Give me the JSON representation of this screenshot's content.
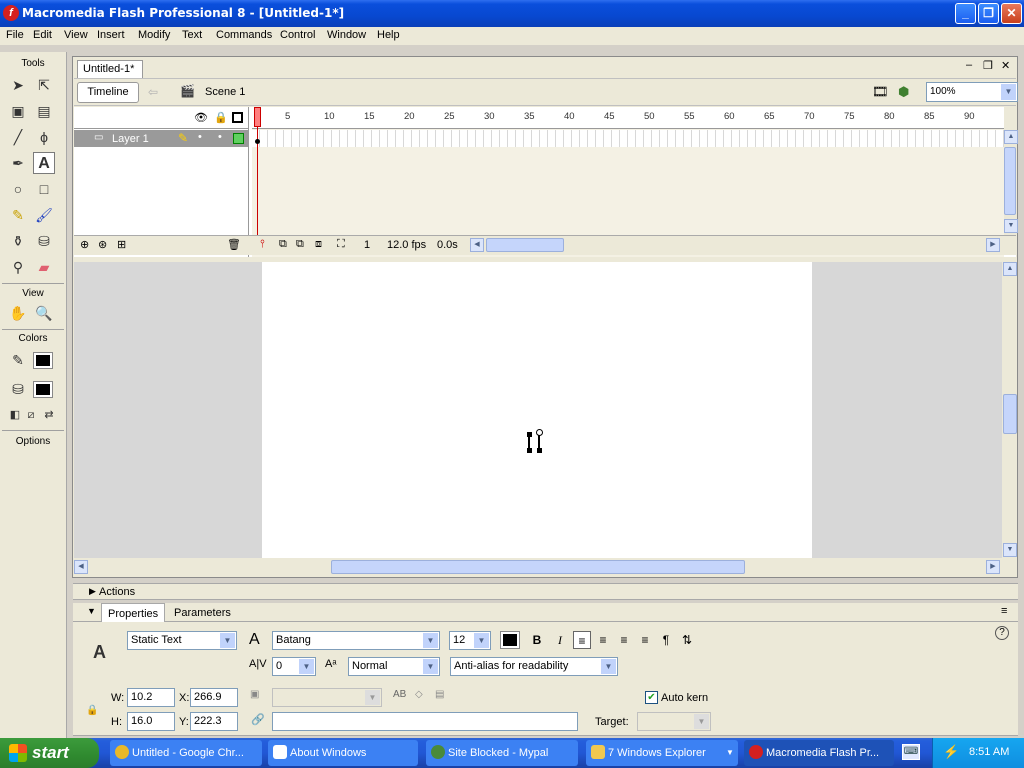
{
  "window": {
    "title": "Macromedia Flash Professional 8 - [Untitled-1*]",
    "app_icon_glyph": "f"
  },
  "menu": [
    "File",
    "Edit",
    "View",
    "Insert",
    "Modify",
    "Text",
    "Commands",
    "Control",
    "Window",
    "Help"
  ],
  "tools": {
    "title": "Tools",
    "view_label": "View",
    "colors_label": "Colors",
    "options_label": "Options"
  },
  "document": {
    "tab": "Untitled-1*",
    "timeline_button": "Timeline",
    "scene": "Scene 1",
    "zoom": "100%"
  },
  "timeline": {
    "layer_name": "Layer 1",
    "ruler": [
      "1",
      "5",
      "10",
      "15",
      "20",
      "25",
      "30",
      "35",
      "40",
      "45",
      "50",
      "55",
      "60",
      "65",
      "70",
      "75",
      "80",
      "85",
      "90"
    ],
    "current_frame": "1",
    "fps": "12.0 fps",
    "elapsed": "0.0s"
  },
  "panels": {
    "actions_label": "Actions",
    "properties_tab": "Properties",
    "parameters_tab": "Parameters"
  },
  "properties": {
    "text_type": "Static Text",
    "font": "Batang",
    "font_size": "12",
    "letter_spacing": "0",
    "char_position": "Normal",
    "anti_alias": "Anti-alias for readability",
    "w_label": "W:",
    "w": "10.2",
    "h_label": "H:",
    "h": "16.0",
    "x_label": "X:",
    "x": "266.9",
    "y_label": "Y:",
    "y": "222.3",
    "auto_kern": "Auto kern",
    "target_label": "Target:",
    "bold": "B",
    "italic": "I"
  },
  "taskbar": {
    "start": "start",
    "tasks": [
      {
        "label": "Untitled - Google Chr...",
        "color": "#e8b82a"
      },
      {
        "label": "About Windows",
        "color": "#ffffff"
      },
      {
        "label": "Site Blocked - Mypal",
        "color": "#4a8a3a"
      },
      {
        "label": "7 Windows Explorer",
        "color": "#f0c850"
      },
      {
        "label": "Macromedia Flash Pr...",
        "color": "#d42020"
      }
    ],
    "clock": "8:51 AM"
  },
  "colors": {
    "stroke": "#000000",
    "fill": "#000000",
    "titlebar": "#0a4fdc",
    "taskbar": "#245edc"
  }
}
